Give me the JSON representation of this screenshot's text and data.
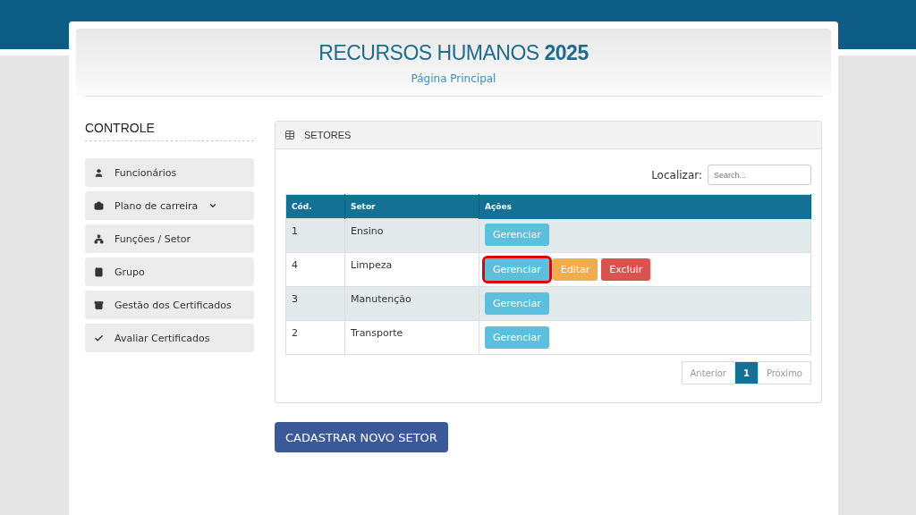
{
  "header": {
    "title": "RECURSOS HUMANOS",
    "title_year": "2025",
    "subtitle": "Página Principal"
  },
  "sidebar": {
    "heading": "CONTROLE",
    "items": [
      {
        "label": "Funcionários",
        "dropdown": false
      },
      {
        "label": "Plano de carreira",
        "dropdown": true
      },
      {
        "label": "Funções / Setor",
        "dropdown": false
      },
      {
        "label": "Grupo",
        "dropdown": false
      },
      {
        "label": "Gestão dos Certificados",
        "dropdown": false
      },
      {
        "label": "Avaliar Certificados",
        "dropdown": false
      }
    ]
  },
  "panel": {
    "title": "SETORES",
    "search_label": "Localizar:",
    "search": {
      "placeholder": "Search..."
    },
    "table": {
      "columns": [
        "Cód.",
        "Setor",
        "Ações"
      ],
      "rows": [
        {
          "code": "1",
          "sector": "Ensino",
          "actions": [
            {
              "kind": "manage",
              "label": "Gerenciar",
              "highlighted": false
            }
          ]
        },
        {
          "code": "4",
          "sector": "Limpeza",
          "actions": [
            {
              "kind": "manage",
              "label": "Gerenciar",
              "highlighted": true
            },
            {
              "kind": "edit",
              "label": "Editar",
              "highlighted": false
            },
            {
              "kind": "delete",
              "label": "Excluir",
              "highlighted": false
            }
          ]
        },
        {
          "code": "3",
          "sector": "Manutenção",
          "actions": [
            {
              "kind": "manage",
              "label": "Gerenciar",
              "highlighted": false
            }
          ]
        },
        {
          "code": "2",
          "sector": "Transporte",
          "actions": [
            {
              "kind": "manage",
              "label": "Gerenciar",
              "highlighted": false
            }
          ]
        }
      ]
    },
    "pagination": [
      {
        "label": "Anterior",
        "selected": false
      },
      {
        "label": "1",
        "selected": true
      },
      {
        "label": "Próximo",
        "selected": false
      }
    ]
  },
  "new_button": "CADASTRAR NOVO SETOR"
}
